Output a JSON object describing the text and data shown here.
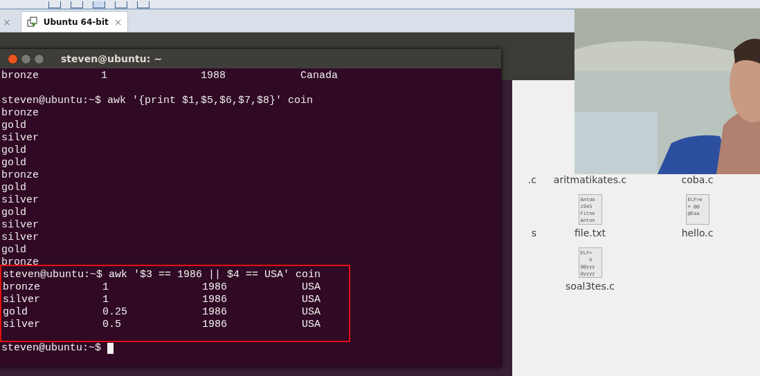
{
  "tabs": [
    {
      "close": "×",
      "selected": false
    },
    {
      "label": "Ubuntu 64-bit",
      "close": "×",
      "selected": true
    }
  ],
  "terminal": {
    "title": "steven@ubuntu: ~",
    "lines": [
      {
        "text": "bronze          1               1988            Canada",
        "highlighted": false
      },
      {
        "highlighted": false
      },
      {
        "text": "steven@ubuntu:~$ awk '{print $1,$5,$6,$7,$8}' coin",
        "highlighted": false
      },
      {
        "text": "bronze",
        "highlighted": false
      },
      {
        "text": "gold",
        "highlighted": false
      },
      {
        "text": "silver",
        "highlighted": false
      },
      {
        "text": "gold",
        "highlighted": false
      },
      {
        "text": "gold",
        "highlighted": false
      },
      {
        "text": "bronze",
        "highlighted": false
      },
      {
        "text": "gold",
        "highlighted": false
      },
      {
        "text": "silver",
        "highlighted": false
      },
      {
        "text": "gold",
        "highlighted": false
      },
      {
        "text": "silver",
        "highlighted": false
      },
      {
        "text": "silver",
        "highlighted": false
      },
      {
        "text": "gold",
        "highlighted": false
      },
      {
        "text": "bronze",
        "highlighted": false
      },
      {
        "text": "steven@ubuntu:~$ awk '$3 == 1986 || $4 == USA' coin",
        "highlighted": true
      },
      {
        "text": "bronze          1               1986            USA",
        "highlighted": true
      },
      {
        "text": "silver          1               1986            USA",
        "highlighted": true
      },
      {
        "text": "gold            0.25            1986            USA",
        "highlighted": true
      },
      {
        "text": "silver          0.5             1986            USA",
        "highlighted": true
      }
    ],
    "prompt": "steven@ubuntu:~$"
  },
  "file_columns": [
    [
      {
        "label": ".c"
      },
      {
        "label": "s"
      }
    ],
    [
      {
        "label": "aritmatikates.c"
      },
      {
        "label": "file.txt",
        "preview": [
          "Antom",
          "1945",
          "Fitne",
          "Anton"
        ]
      },
      {
        "label": "soal3tes.c",
        "preview": [
          "ELF>",
          "   h",
          "@@yyy",
          "@yyyy"
        ]
      }
    ],
    [
      {
        "label": "coba.c"
      },
      {
        "label": "hello.c",
        "preview": [
          "ELF>e",
          "= @@",
          "@Eaa"
        ]
      }
    ]
  ],
  "webcam": {
    "kind": "picture"
  }
}
